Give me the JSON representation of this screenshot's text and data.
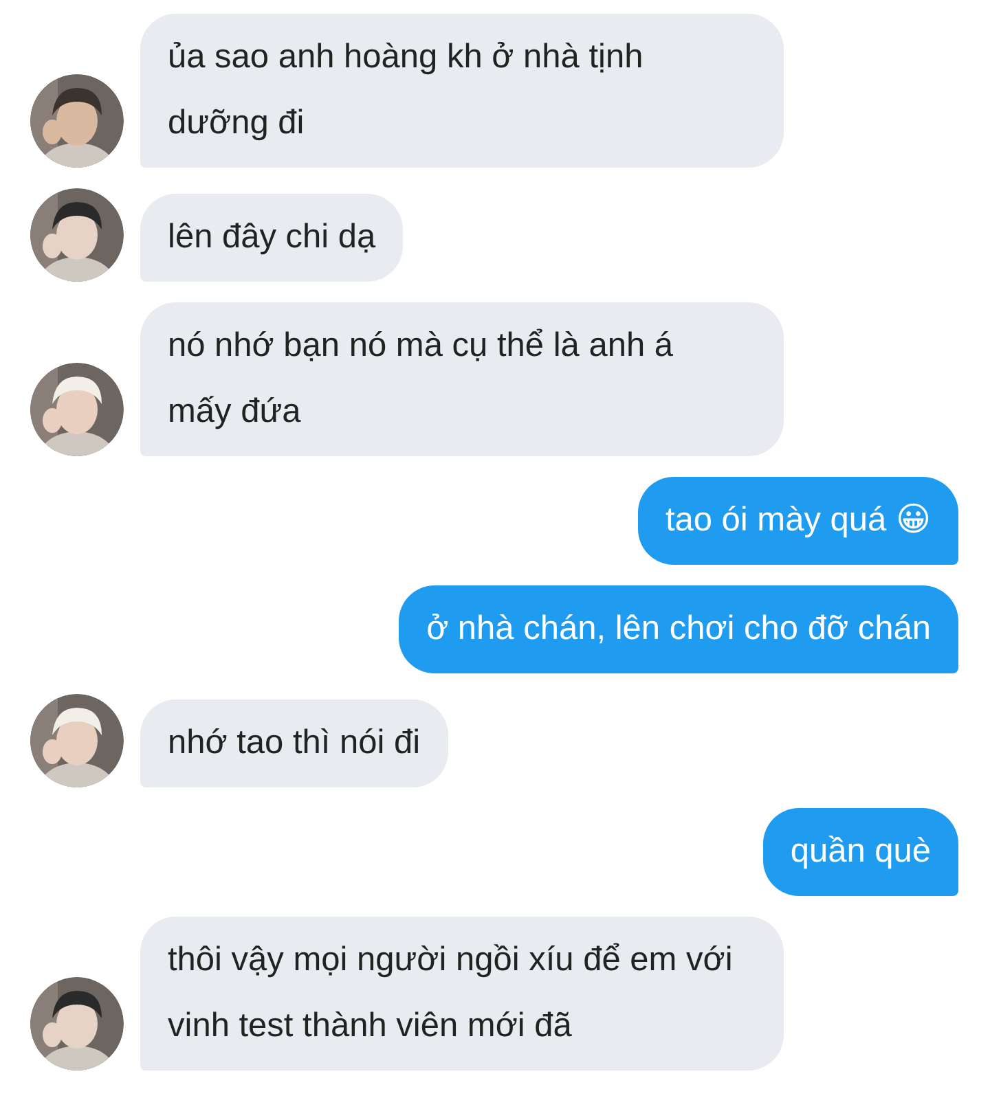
{
  "messages": [
    {
      "kind": "incoming",
      "text": "ủa sao anh hoàng kh ở nhà tịnh\ndưỡng đi"
    },
    {
      "kind": "incoming",
      "text": "lên đây chi dạ"
    },
    {
      "kind": "incoming",
      "text": "nó nhớ bạn nó mà cụ thể là anh á\nmấy đứa"
    },
    {
      "kind": "outgoing",
      "text": "tao ói mày quá 😀"
    },
    {
      "kind": "outgoing",
      "text": "ở nhà chán, lên chơi cho đỡ chán"
    },
    {
      "kind": "incoming",
      "text": "nhớ tao thì nói đi"
    },
    {
      "kind": "outgoing",
      "text": "quần què"
    },
    {
      "kind": "incoming",
      "text": "thôi vậy mọi người ngồi xíu để em với\nvinh test thành viên mới đã"
    }
  ]
}
